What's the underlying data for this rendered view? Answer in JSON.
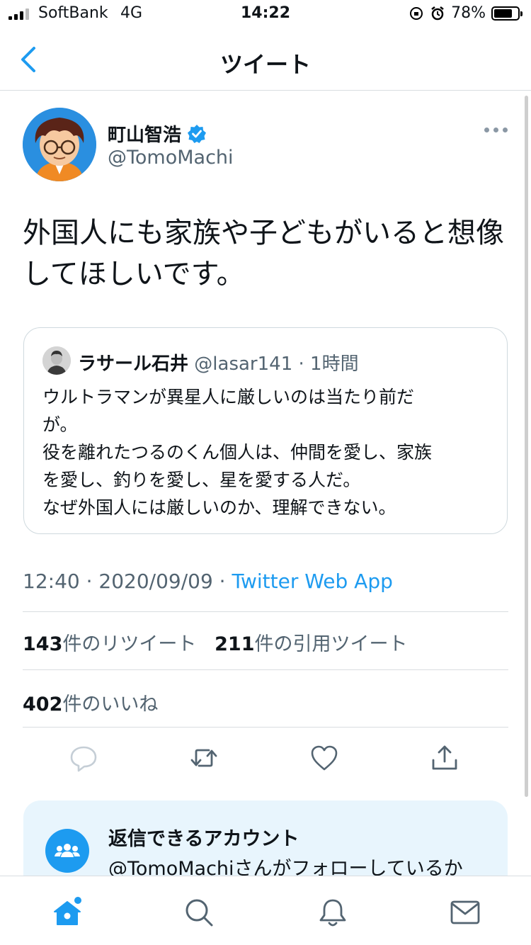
{
  "status_bar": {
    "carrier": "SoftBank",
    "network": "4G",
    "time": "14:22",
    "battery": "78%",
    "battery_level": 0.78
  },
  "header": {
    "title": "ツイート"
  },
  "tweet": {
    "author_name": "町山智浩",
    "handle": "@TomoMachi",
    "text": "外国人にも家族や子どもがいると想像してほしいです。",
    "timestamp": "12:40 · 2020/09/09 · ",
    "via": "Twitter Web App"
  },
  "quoted_tweet": {
    "author_name": "ラサール石井",
    "handle": "@lasar141",
    "time": "· 1時間",
    "lines": [
      "ウルトラマンが異星人に厳しいのは当たり前だ",
      "が。",
      "役を離れたつるのくん個人は、仲間を愛し、家族",
      "を愛し、釣りを愛し、星を愛する人だ。",
      "なぜ外国人には厳しいのか、理解できない。"
    ]
  },
  "stats": {
    "retweets_count": "143",
    "retweets_label": "件のリツイート",
    "quotes_count": "211",
    "quotes_label": "件の引用ツイート",
    "likes_count": "402",
    "likes_label": "件のいいね"
  },
  "reply_card": {
    "title": "返信できるアカウント",
    "body": "@TomoMachiさんがフォローしているか"
  },
  "colors": {
    "accent": "#1d9bf0",
    "secondary_text": "#536471",
    "divider": "#d9dde0",
    "card_bg": "#e8f5fd"
  },
  "icons": {
    "back": "chevron-left-icon",
    "verified": "verified-badge-icon",
    "more": "more-horizontal-icon",
    "reply": "reply-icon",
    "retweet": "retweet-icon",
    "like": "heart-icon",
    "share": "share-icon",
    "people": "people-icon",
    "home": "home-icon",
    "search": "search-icon",
    "notifications": "bell-icon",
    "messages": "mail-icon"
  }
}
